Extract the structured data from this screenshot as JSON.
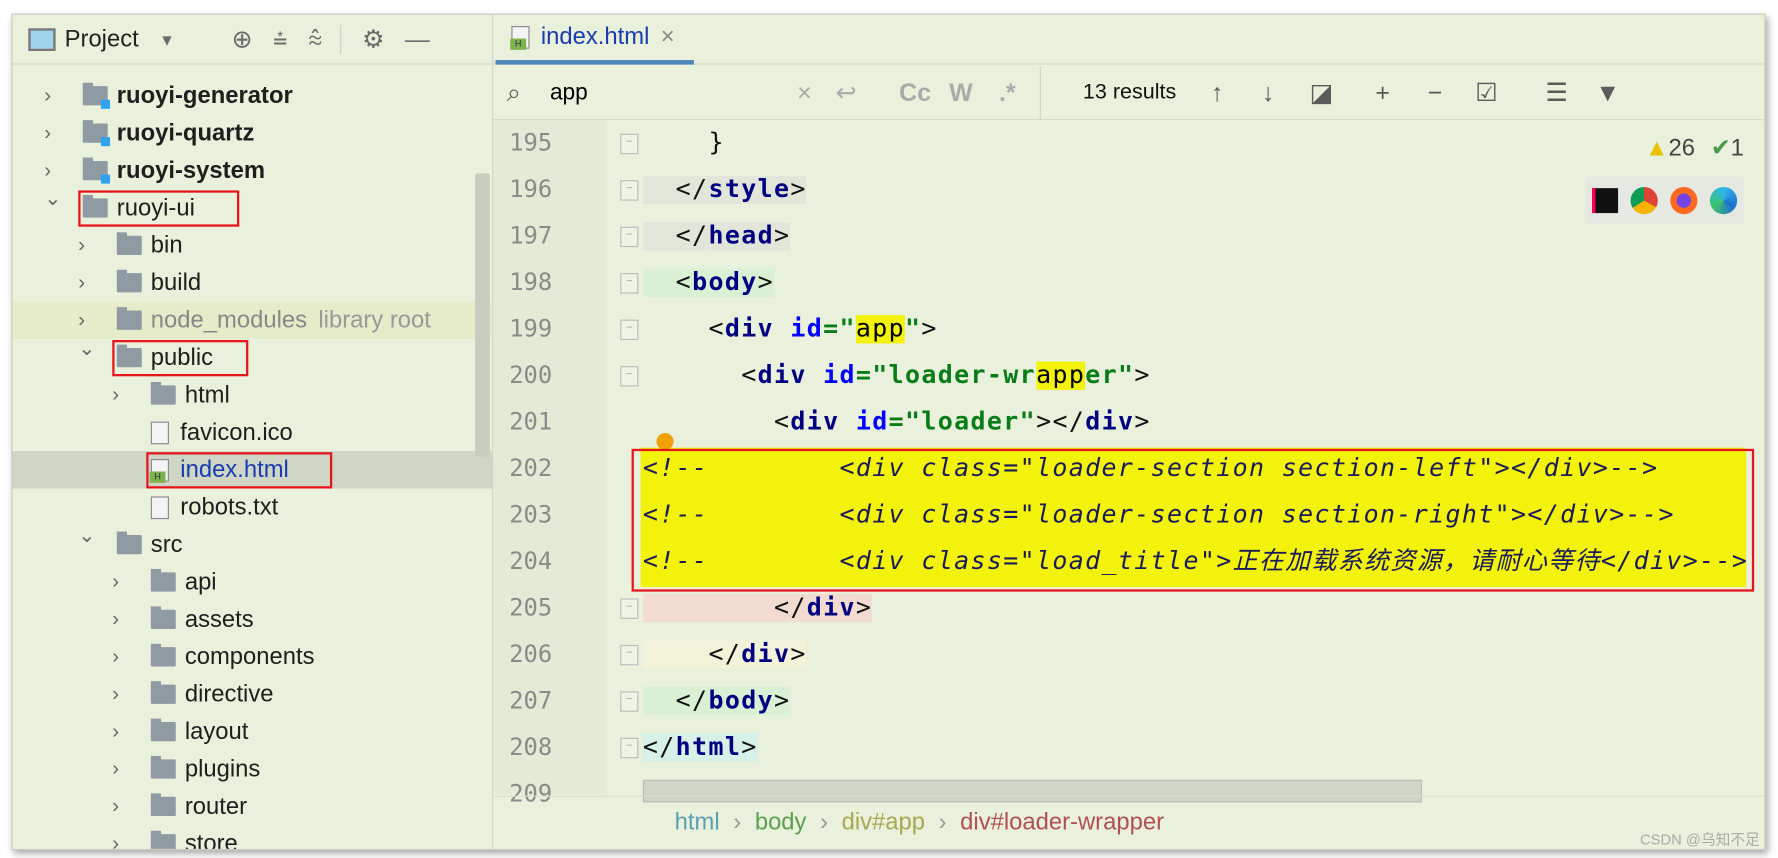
{
  "sidebar": {
    "title": "Project",
    "items": [
      {
        "label": "ruoyi-generator",
        "kind": "module",
        "level": 1,
        "open": false,
        "bold": true
      },
      {
        "label": "ruoyi-quartz",
        "kind": "module",
        "level": 1,
        "open": false,
        "bold": true
      },
      {
        "label": "ruoyi-system",
        "kind": "module",
        "level": 1,
        "open": false,
        "bold": true
      },
      {
        "label": "ruoyi-ui",
        "kind": "folder",
        "level": 1,
        "open": true,
        "boxed": true
      },
      {
        "label": "bin",
        "kind": "folder",
        "level": 2,
        "open": false
      },
      {
        "label": "build",
        "kind": "folder",
        "level": 2,
        "open": false
      },
      {
        "label": "node_modules",
        "kind": "folder",
        "level": 2,
        "open": false,
        "suffix": "library root",
        "excluded": true
      },
      {
        "label": "public",
        "kind": "folder",
        "level": 2,
        "open": true,
        "boxed": true
      },
      {
        "label": "html",
        "kind": "folder",
        "level": 3,
        "open": false
      },
      {
        "label": "favicon.ico",
        "kind": "file",
        "level": 3
      },
      {
        "label": "index.html",
        "kind": "html",
        "level": 3,
        "selected": true,
        "boxed": true
      },
      {
        "label": "robots.txt",
        "kind": "file",
        "level": 3
      },
      {
        "label": "src",
        "kind": "folder",
        "level": 2,
        "open": true
      },
      {
        "label": "api",
        "kind": "folder",
        "level": 3,
        "open": false
      },
      {
        "label": "assets",
        "kind": "folder",
        "level": 3,
        "open": false
      },
      {
        "label": "components",
        "kind": "folder",
        "level": 3,
        "open": false
      },
      {
        "label": "directive",
        "kind": "folder",
        "level": 3,
        "open": false
      },
      {
        "label": "layout",
        "kind": "folder",
        "level": 3,
        "open": false
      },
      {
        "label": "plugins",
        "kind": "folder",
        "level": 3,
        "open": false
      },
      {
        "label": "router",
        "kind": "folder",
        "level": 3,
        "open": false
      },
      {
        "label": "store",
        "kind": "folder",
        "level": 3,
        "open": false
      }
    ]
  },
  "tab": {
    "label": "index.html"
  },
  "search": {
    "value": "app",
    "results": "13 results",
    "case": "Cc",
    "word": "W",
    "regex": ".*"
  },
  "inspections": {
    "warnings": "26",
    "ok": "1"
  },
  "code": [
    {
      "num": "195",
      "tokens": [
        {
          "t": "    }",
          "c": "br"
        }
      ]
    },
    {
      "num": "196",
      "tokens": [
        {
          "t": "  </",
          "c": "br"
        },
        {
          "t": "style",
          "c": "tag"
        },
        {
          "t": ">",
          "c": "br"
        }
      ]
    },
    {
      "num": "197",
      "tokens": [
        {
          "t": "  </",
          "c": "br"
        },
        {
          "t": "head",
          "c": "tag"
        },
        {
          "t": ">",
          "c": "br"
        }
      ]
    },
    {
      "num": "198",
      "tokens": [
        {
          "t": "  <",
          "c": "br"
        },
        {
          "t": "body",
          "c": "tag"
        },
        {
          "t": ">",
          "c": "br"
        }
      ]
    },
    {
      "num": "199",
      "tokens": [
        {
          "t": "    <",
          "c": "br"
        },
        {
          "t": "div",
          "c": "tag"
        },
        {
          "t": " id",
          "c": "attr"
        },
        {
          "t": "=\"",
          "c": "str"
        },
        {
          "t": "app",
          "c": "hl"
        },
        {
          "t": "\"",
          "c": "str"
        },
        {
          "t": ">",
          "c": "br"
        }
      ]
    },
    {
      "num": "200",
      "tokens": [
        {
          "t": "      <",
          "c": "br"
        },
        {
          "t": "div",
          "c": "tag"
        },
        {
          "t": " id",
          "c": "attr"
        },
        {
          "t": "=\"loader-wr",
          "c": "str"
        },
        {
          "t": "app",
          "c": "hl"
        },
        {
          "t": "er\"",
          "c": "str"
        },
        {
          "t": ">",
          "c": "br"
        }
      ]
    },
    {
      "num": "201",
      "tokens": [
        {
          "t": "        <",
          "c": "br"
        },
        {
          "t": "div",
          "c": "tag"
        },
        {
          "t": " id",
          "c": "attr"
        },
        {
          "t": "=\"loader\"",
          "c": "str"
        },
        {
          "t": "></",
          "c": "br"
        },
        {
          "t": "div",
          "c": "tag"
        },
        {
          "t": ">",
          "c": "br"
        }
      ]
    },
    {
      "num": "202",
      "tokens": [
        {
          "t": "<!--        <div class=\"loader-section section-left\"></div>-->",
          "c": "cm"
        }
      ]
    },
    {
      "num": "203",
      "tokens": [
        {
          "t": "<!--        <div class=\"loader-section section-right\"></div>-->",
          "c": "cm"
        }
      ]
    },
    {
      "num": "204",
      "tokens": [
        {
          "t": "<!--        <div class=\"load_title\">正在加载系统资源，请耐心等待</div>-->",
          "c": "cm"
        }
      ]
    },
    {
      "num": "205",
      "tokens": [
        {
          "t": "        </",
          "c": "br"
        },
        {
          "t": "div",
          "c": "tag"
        },
        {
          "t": ">",
          "c": "br"
        }
      ]
    },
    {
      "num": "206",
      "tokens": [
        {
          "t": "    </",
          "c": "br"
        },
        {
          "t": "div",
          "c": "tag"
        },
        {
          "t": ">",
          "c": "br"
        }
      ]
    },
    {
      "num": "207",
      "tokens": [
        {
          "t": "  </",
          "c": "br"
        },
        {
          "t": "body",
          "c": "tag"
        },
        {
          "t": ">",
          "c": "br"
        }
      ]
    },
    {
      "num": "208",
      "tokens": [
        {
          "t": "</",
          "c": "br"
        },
        {
          "t": "html",
          "c": "tag"
        },
        {
          "t": ">",
          "c": "br"
        }
      ]
    },
    {
      "num": "209",
      "tokens": []
    }
  ],
  "breadcrumb": [
    {
      "label": "html",
      "color": "#5aa0b0"
    },
    {
      "label": "body",
      "color": "#5aa050"
    },
    {
      "label": "div#app",
      "color": "#a8a850"
    },
    {
      "label": "div#loader-wrapper",
      "color": "#b05050"
    }
  ],
  "watermark": "CSDN @乌知不足"
}
